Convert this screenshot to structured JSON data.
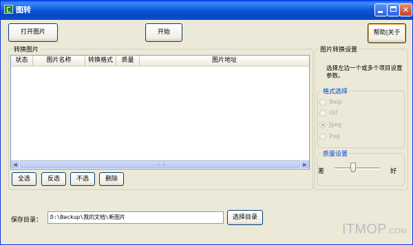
{
  "window": {
    "title": "图转"
  },
  "toolbar": {
    "open_label": "打开图片",
    "start_label": "开始",
    "help_label": "帮助|关于"
  },
  "convert_group": {
    "label": "转换图片",
    "columns": [
      "状态",
      "图片名称",
      "转换格式",
      "质量",
      "图片地址"
    ],
    "rows": []
  },
  "selection_buttons": {
    "select_all": "全选",
    "invert": "反选",
    "none": "不选",
    "delete": "删除"
  },
  "settings": {
    "label": "图片转换设置",
    "hint": "选择左边一个或多个项目设置参数。",
    "format_group": {
      "label": "格式选择",
      "options": [
        "Bmp",
        "Gif",
        "Jpeg",
        "Png"
      ],
      "selected": "Jpeg"
    },
    "quality_group": {
      "label": "质量设置",
      "low_label": "差",
      "high_label": "好",
      "level": 0.4
    }
  },
  "save": {
    "label": "保存目录：",
    "path": "D:\\Backup\\我的文档\\新图片",
    "browse_label": "选择目录"
  },
  "watermark": {
    "main": "ITMOP",
    "suffix": ".COM"
  },
  "colors": {
    "titlebar": "#0A5EE8",
    "face": "#ECE9D8",
    "group_label": "#0046D5"
  }
}
